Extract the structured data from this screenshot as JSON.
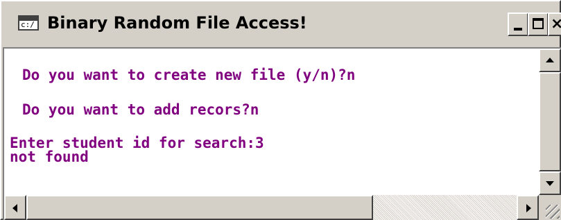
{
  "window": {
    "title": "Binary Random File Access!",
    "icon_glyph": "c:/"
  },
  "titlebar_buttons": {
    "minimize_icon": "minimize-icon",
    "maximize_icon": "maximize-icon",
    "close_glyph": "×"
  },
  "console": {
    "text_color": "#800080",
    "background": "#ffffff",
    "lines": [
      "Do you want to create new file (y/n)?n",
      "Do you want to add recors?n",
      "Enter student id for search:3",
      "not found"
    ]
  }
}
